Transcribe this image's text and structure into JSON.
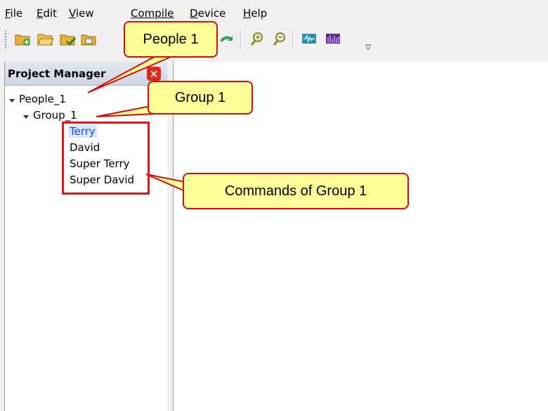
{
  "menu": [
    {
      "mn": "F",
      "rest": "ile"
    },
    {
      "mn": "E",
      "rest": "dit"
    },
    {
      "mn": "V",
      "rest": "iew"
    },
    {
      "mn": "",
      "rest": "Compile"
    },
    {
      "mn": "D",
      "rest": "evice"
    },
    {
      "mn": "H",
      "rest": "elp"
    }
  ],
  "toolbar": {
    "icons": [
      "new-project-icon",
      "open-folder-icon",
      "save-project-icon",
      "save-as-icon",
      "redo-icon",
      "zoom-in-icon",
      "zoom-out-icon",
      "waveform-icon",
      "spectrum-icon"
    ]
  },
  "project_manager": {
    "title": "Project Manager",
    "close_glyph": "×",
    "tree": {
      "root": "People_1",
      "group": "Group_1",
      "items": [
        "Terry",
        "David",
        "Super Terry",
        "Super David"
      ],
      "selected": "Terry"
    }
  },
  "callouts": {
    "people": "People 1",
    "group": "Group 1",
    "commands": "Commands of Group 1"
  },
  "colors": {
    "callout_fill": "#ffff99",
    "annotation_red": "#e01818",
    "selection_text": "#1a4fd6"
  }
}
